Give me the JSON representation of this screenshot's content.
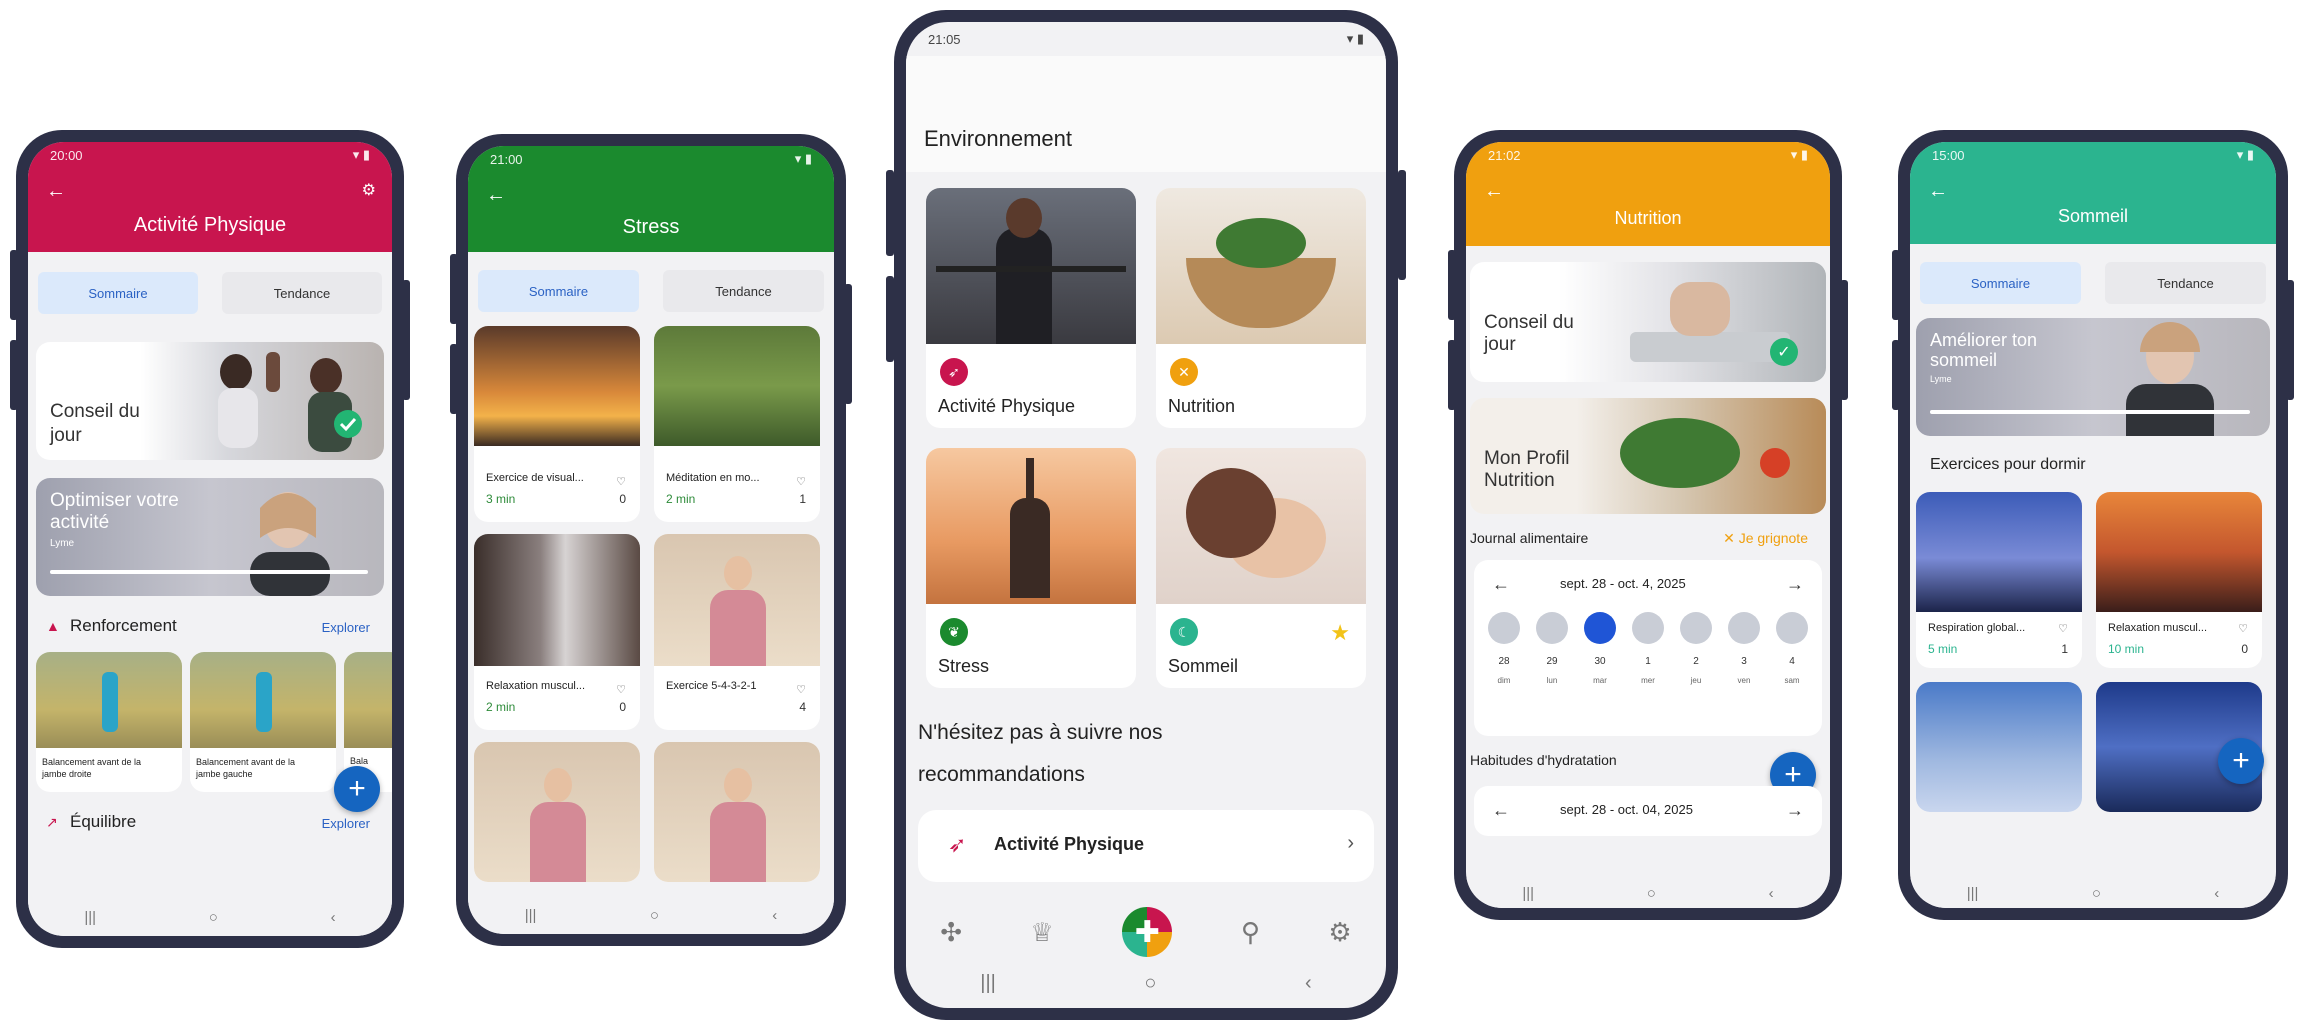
{
  "colors": {
    "activite": "#c8154e",
    "stress": "#1b8a2e",
    "nutrition": "#f0a00f",
    "sommeil": "#2bb48f",
    "accent_blue": "#1565c0"
  },
  "status_time": "21:05",
  "phone1": {
    "status_time": "20:00",
    "title": "Activité Physique",
    "tabs": [
      "Sommaire",
      "Tendance"
    ],
    "conseil": "Conseil du jour",
    "video_title": "Optimiser votre activité",
    "video_sub": "Lyme",
    "section1": "Renforcement",
    "section2": "Équilibre",
    "explore": "Explorer",
    "exercises": [
      "Balancement avant de la jambe droite",
      "Balancement avant de la jambe gauche",
      "Bala"
    ]
  },
  "phone2": {
    "status_time": "21:00",
    "title": "Stress",
    "tabs": [
      "Sommaire",
      "Tendance"
    ],
    "cards": [
      {
        "title": "Exercice de visual...",
        "dur": "3 min",
        "count": "0"
      },
      {
        "title": "Méditation en mo...",
        "dur": "2 min",
        "count": "1"
      },
      {
        "title": "Relaxation muscul...",
        "dur": "2 min",
        "count": "0"
      },
      {
        "title": "Exercice 5-4-3-2-1",
        "dur": "",
        "count": "4"
      }
    ]
  },
  "phone3": {
    "status_time": "21:05",
    "heading": "Environnement",
    "tiles": [
      {
        "label": "Activité Physique",
        "icon": "run-icon"
      },
      {
        "label": "Nutrition",
        "icon": "utensils-icon"
      },
      {
        "label": "Stress",
        "icon": "leaf-icon"
      },
      {
        "label": "Sommeil",
        "icon": "moon-icon"
      }
    ],
    "reco_text": "N'hésitez pas à suivre nos recommandations",
    "reco_item": "Activité Physique",
    "nav_icons": [
      "puzzle-icon",
      "trophy-icon",
      "home-plus-icon",
      "location-icon",
      "settings-icon"
    ]
  },
  "phone4": {
    "status_time": "21:02",
    "title": "Nutrition",
    "conseil": "Conseil du jour",
    "profil": "Mon Profil Nutrition",
    "journal": "Journal alimentaire",
    "journal_action": "Je grignote",
    "week": "sept. 28 - oct. 4, 2025",
    "days": [
      "28",
      "29",
      "30",
      "1",
      "2",
      "3",
      "4"
    ],
    "weekdays": [
      "dim",
      "lun",
      "mar",
      "mer",
      "jeu",
      "ven",
      "sam"
    ],
    "hydration": "Habitudes d'hydratation",
    "week2": "sept. 28 - oct. 04, 2025"
  },
  "phone5": {
    "status_time": "15:00",
    "title": "Sommeil",
    "tabs": [
      "Sommaire",
      "Tendance"
    ],
    "video_title": "Améliorer ton sommeil",
    "video_sub": "Lyme",
    "exercises_title": "Exercices pour dormir",
    "cards": [
      {
        "title": "Respiration global...",
        "dur": "5 min",
        "count": "1"
      },
      {
        "title": "Relaxation muscul...",
        "dur": "10 min",
        "count": "0"
      }
    ]
  },
  "nav": [
    "|||",
    "○",
    "‹"
  ]
}
